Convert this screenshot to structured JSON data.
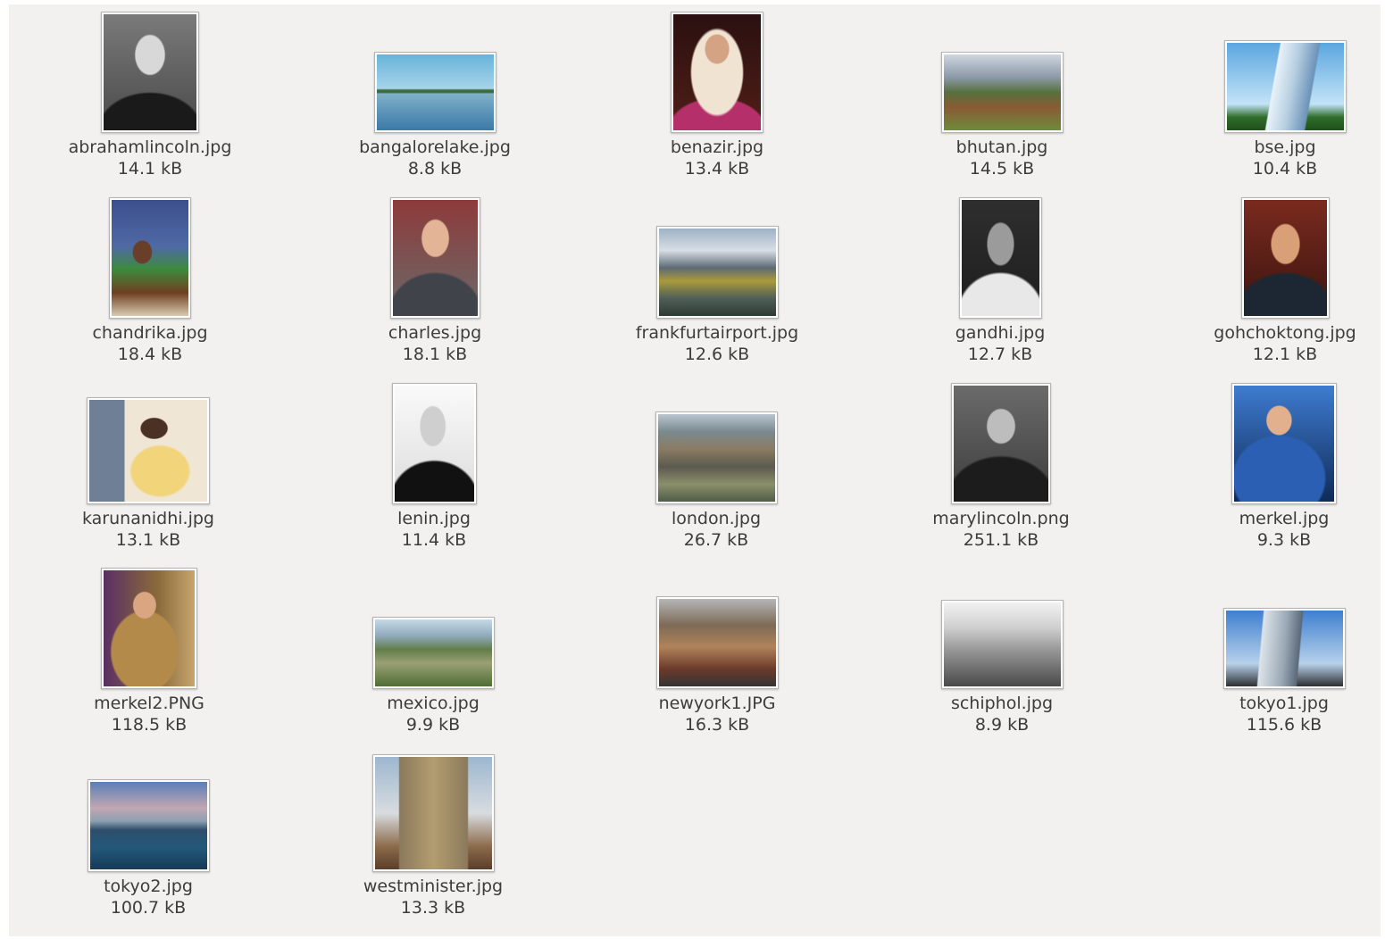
{
  "files": [
    {
      "name": "abrahamlincoln.jpg",
      "size": "14.1 kB",
      "icon": "image-thumbnail"
    },
    {
      "name": "bangalorelake.jpg",
      "size": "8.8 kB",
      "icon": "image-thumbnail"
    },
    {
      "name": "benazir.jpg",
      "size": "13.4 kB",
      "icon": "image-thumbnail"
    },
    {
      "name": "bhutan.jpg",
      "size": "14.5 kB",
      "icon": "image-thumbnail"
    },
    {
      "name": "bse.jpg",
      "size": "10.4 kB",
      "icon": "image-thumbnail"
    },
    {
      "name": "chandrika.jpg",
      "size": "18.4 kB",
      "icon": "image-thumbnail"
    },
    {
      "name": "charles.jpg",
      "size": "18.1 kB",
      "icon": "image-thumbnail"
    },
    {
      "name": "frankfurtairport.jpg",
      "size": "12.6 kB",
      "icon": "image-thumbnail"
    },
    {
      "name": "gandhi.jpg",
      "size": "12.7 kB",
      "icon": "image-thumbnail"
    },
    {
      "name": "gohchoktong.jpg",
      "size": "12.1 kB",
      "icon": "image-thumbnail"
    },
    {
      "name": "karunanidhi.jpg",
      "size": "13.1 kB",
      "icon": "image-thumbnail"
    },
    {
      "name": "lenin.jpg",
      "size": "11.4 kB",
      "icon": "image-thumbnail"
    },
    {
      "name": "london.jpg",
      "size": "26.7 kB",
      "icon": "image-thumbnail"
    },
    {
      "name": "marylincoln.png",
      "size": "251.1 kB",
      "icon": "image-thumbnail"
    },
    {
      "name": "merkel.jpg",
      "size": "9.3 kB",
      "icon": "image-thumbnail"
    },
    {
      "name": "merkel2.PNG",
      "size": "118.5 kB",
      "icon": "image-thumbnail"
    },
    {
      "name": "mexico.jpg",
      "size": "9.9 kB",
      "icon": "image-thumbnail"
    },
    {
      "name": "newyork1.JPG",
      "size": "16.3 kB",
      "icon": "image-thumbnail"
    },
    {
      "name": "schiphol.jpg",
      "size": "8.9 kB",
      "icon": "image-thumbnail"
    },
    {
      "name": "tokyo1.jpg",
      "size": "115.6 kB",
      "icon": "image-thumbnail"
    },
    {
      "name": "tokyo2.jpg",
      "size": "100.7 kB",
      "icon": "image-thumbnail"
    },
    {
      "name": "westminister.jpg",
      "size": "13.3 kB",
      "icon": "image-thumbnail"
    }
  ],
  "colors": {
    "view_background": "#f2f1f0",
    "label_text": "#3c3c3c",
    "thumbnail_border": "#b4b4b4"
  }
}
